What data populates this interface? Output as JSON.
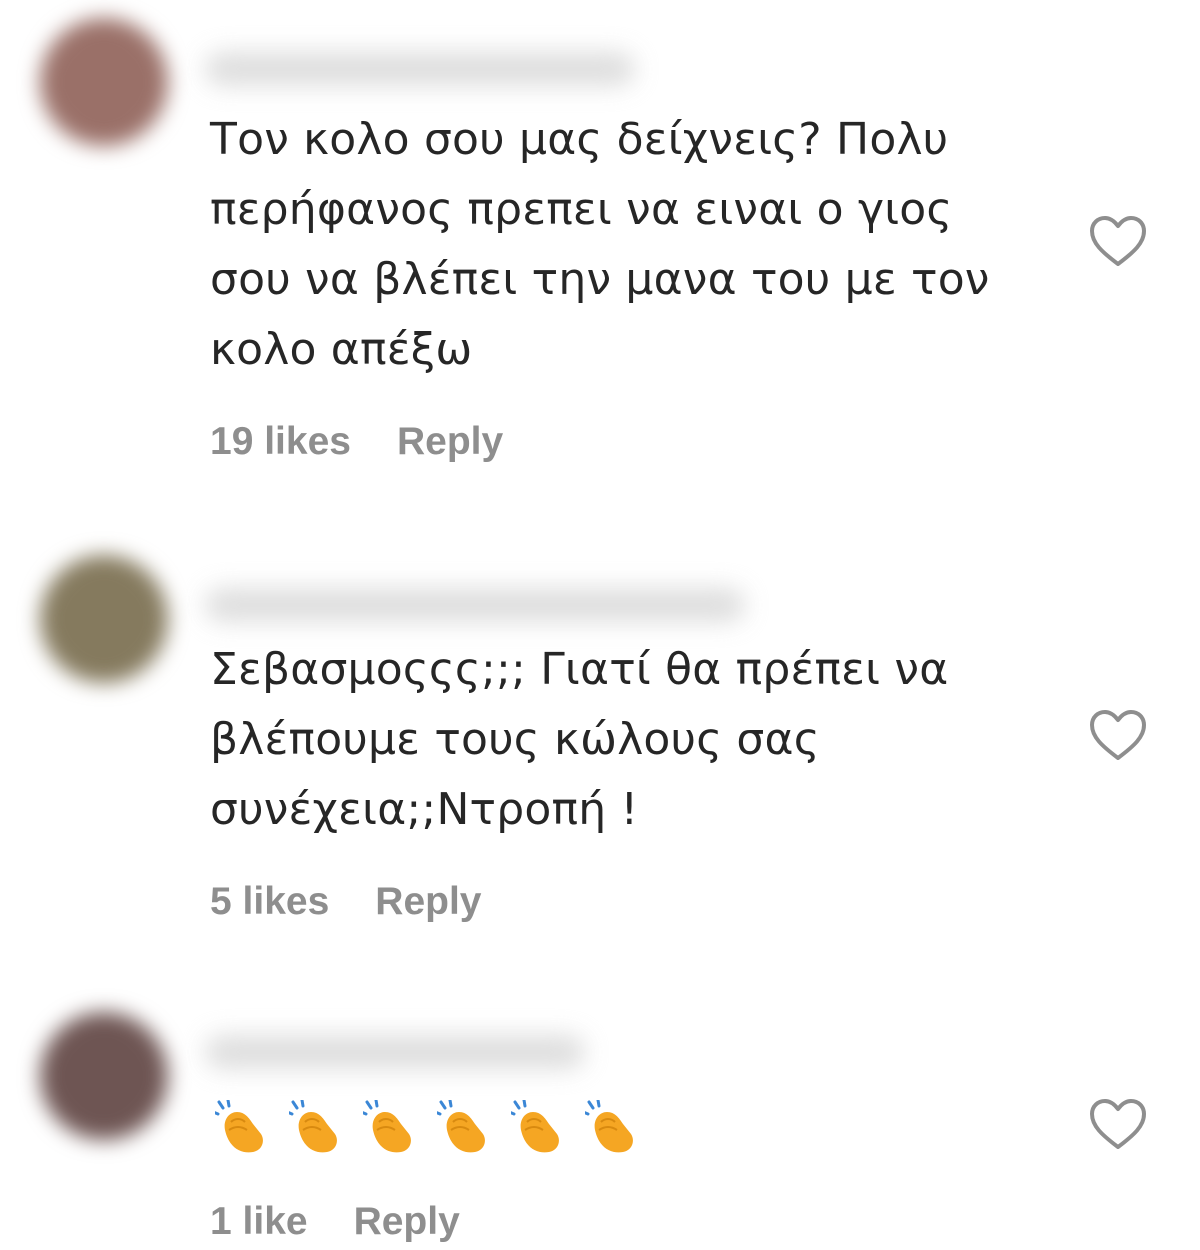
{
  "comments": [
    {
      "text": "Τον κολο σου μας δείχνεις? Πολυ\nπερήφανος πρεπει να ειναι ο γιος\nσου να βλέπει την μανα του με τον\nκολο απέξω",
      "likes": "19 likes",
      "reply": "Reply",
      "avatar_color": "#9a7068",
      "icons": {
        "like": "heart-outline-icon"
      }
    },
    {
      "text": "Σεβασμοςςς;;; Γιατί θα πρέπει να\nβλέπουμε τους κώλους σας\nσυνέχεια;;Ντροπή !",
      "likes": "5 likes",
      "reply": "Reply",
      "avatar_color": "#857a5e",
      "icons": {
        "like": "heart-outline-icon"
      }
    },
    {
      "emoji": [
        "clapping-hands",
        "clapping-hands",
        "clapping-hands",
        "clapping-hands",
        "clapping-hands",
        "clapping-hands"
      ],
      "likes": "1 like",
      "reply": "Reply",
      "avatar_color": "#6e5553",
      "icons": {
        "like": "heart-outline-icon"
      }
    }
  ],
  "colors": {
    "text": "#262626",
    "meta": "#8e8e8e",
    "clap_fill": "#f5a623",
    "clap_lines": "#3b87d6"
  }
}
